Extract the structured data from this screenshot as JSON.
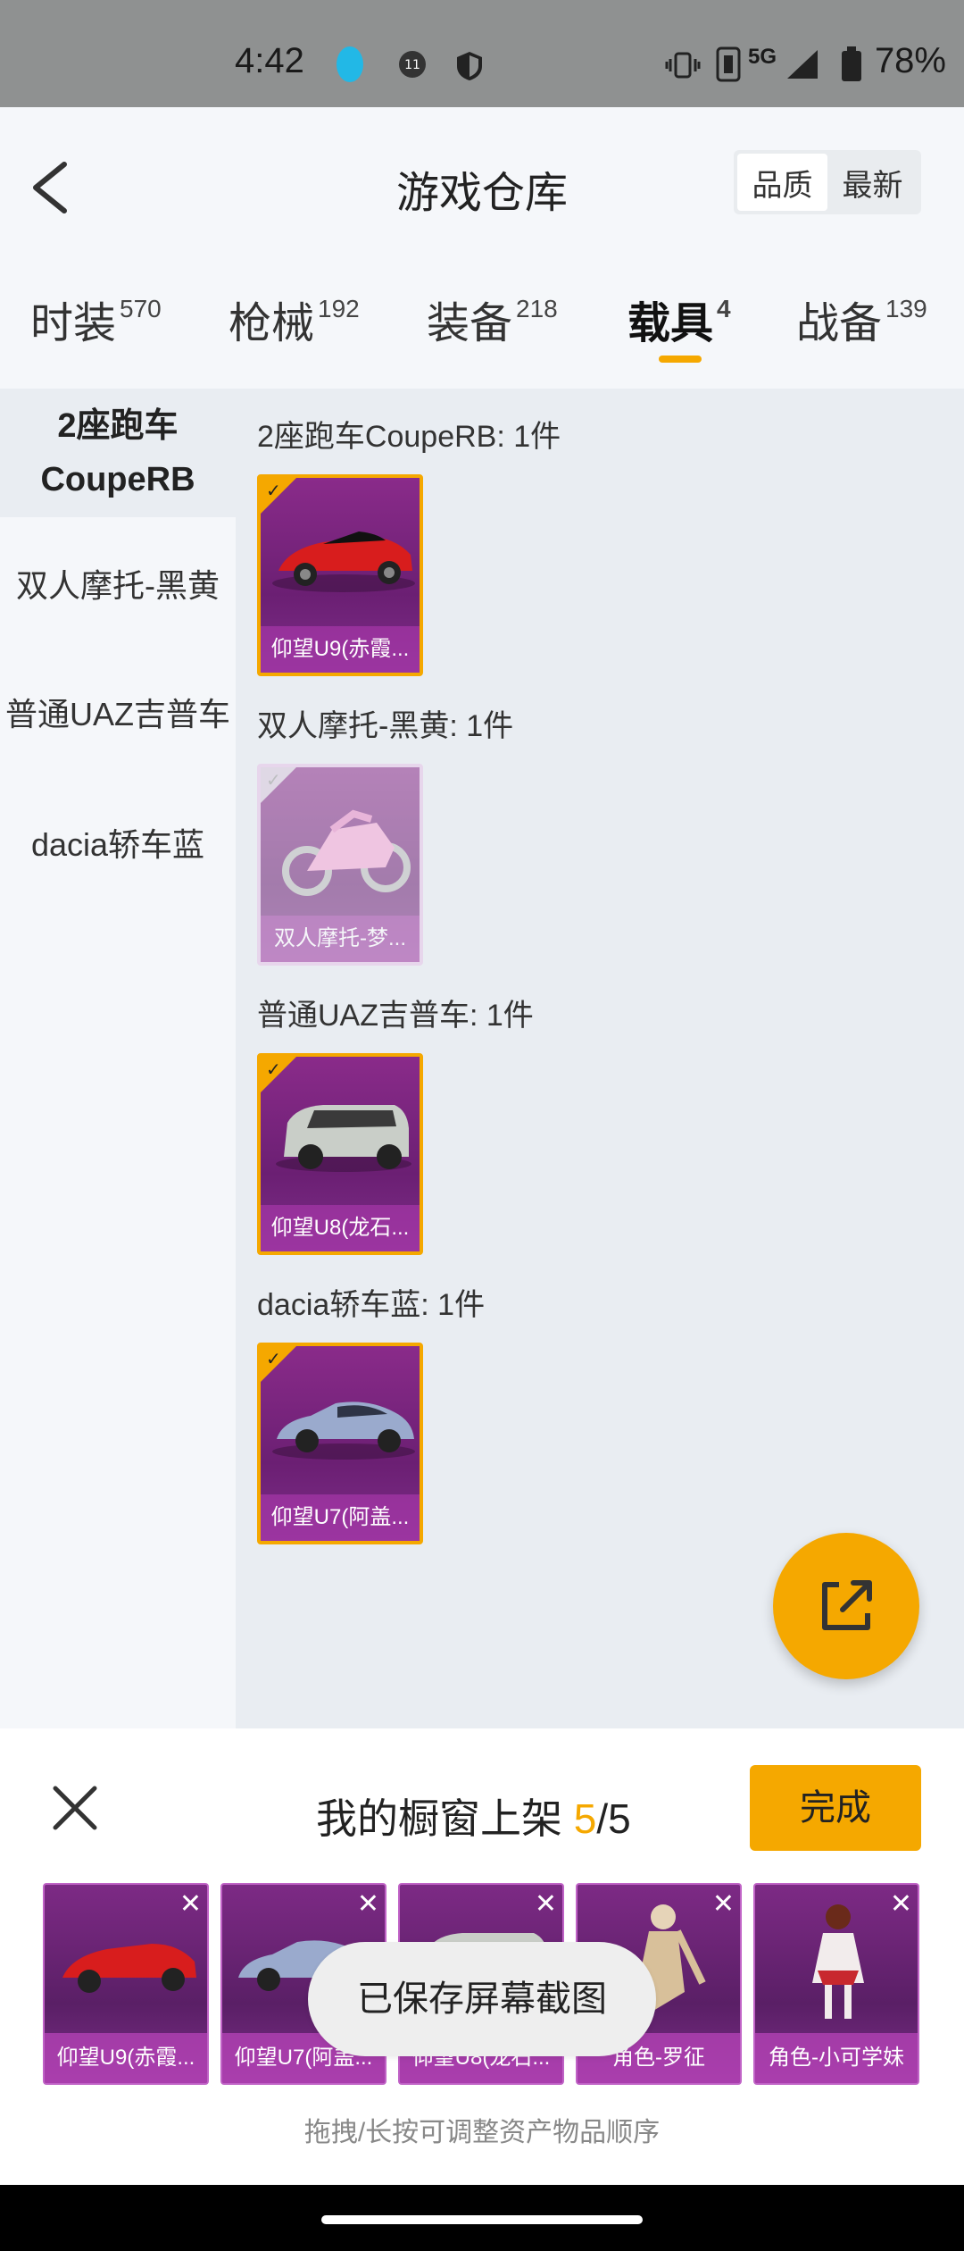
{
  "status_bar": {
    "time": "4:42",
    "network": "5G",
    "battery": "78%"
  },
  "header": {
    "title": "游戏仓库",
    "sort_quality": "品质",
    "sort_newest": "最新"
  },
  "tabs": [
    {
      "label": "时装",
      "count": "570"
    },
    {
      "label": "枪械",
      "count": "192"
    },
    {
      "label": "装备",
      "count": "218"
    },
    {
      "label": "载具",
      "count": "4"
    },
    {
      "label": "战备",
      "count": "139"
    }
  ],
  "sidebar": {
    "items": [
      {
        "label_line1": "2座跑车",
        "label_line2": "CoupeRB"
      },
      {
        "label": "双人摩托-黑黄"
      },
      {
        "label": "普通UAZ吉普车"
      },
      {
        "label": "dacia轿车蓝"
      }
    ]
  },
  "groups": [
    {
      "title": "2座跑车CoupeRB: 1件",
      "item": "仰望U9(赤霞..."
    },
    {
      "title": "双人摩托-黑黄: 1件",
      "item": "双人摩托-梦..."
    },
    {
      "title": "普通UAZ吉普车: 1件",
      "item": "仰望U8(龙石..."
    },
    {
      "title": "dacia轿车蓝: 1件",
      "item": "仰望U7(阿盖..."
    }
  ],
  "sheet": {
    "title": "我的橱窗上架",
    "count": "5",
    "total": "/5",
    "done": "完成",
    "items": [
      "仰望U9(赤霞...",
      "仰望U7(阿盖...",
      "仰望U8(龙石...",
      "角色-罗征",
      "角色-小可学妹"
    ],
    "hint": "拖拽/长按可调整资产物品顺序"
  },
  "toast": "已保存屏幕截图",
  "colors": {
    "accent": "#f5a800",
    "card_purple": "#7d2a85"
  }
}
